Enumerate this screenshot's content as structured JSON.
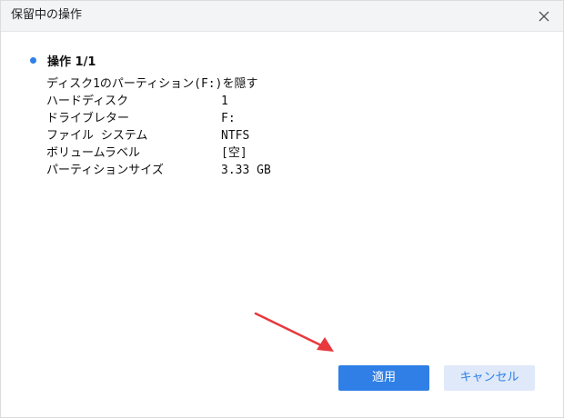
{
  "window": {
    "title": "保留中の操作"
  },
  "operation": {
    "header": "操作 1/1",
    "description": "ディスク1のパーティション(F:)を隠す",
    "details": [
      {
        "label": "ハードディスク",
        "value": "1"
      },
      {
        "label": "ドライブレター",
        "value": "F:"
      },
      {
        "label": "ファイル システム",
        "value": "NTFS"
      },
      {
        "label": "ボリュームラベル",
        "value": "[空]"
      },
      {
        "label": "パーティションサイズ",
        "value": "3.33 GB"
      }
    ]
  },
  "buttons": {
    "apply": "適用",
    "cancel": "キャンセル"
  },
  "colors": {
    "accent": "#2f7fe6",
    "cancel_bg": "#dfe9f9",
    "annotation_arrow": "#e8383d"
  },
  "icons": {
    "close": "close-icon",
    "arrow": "annotation-arrow-icon"
  }
}
